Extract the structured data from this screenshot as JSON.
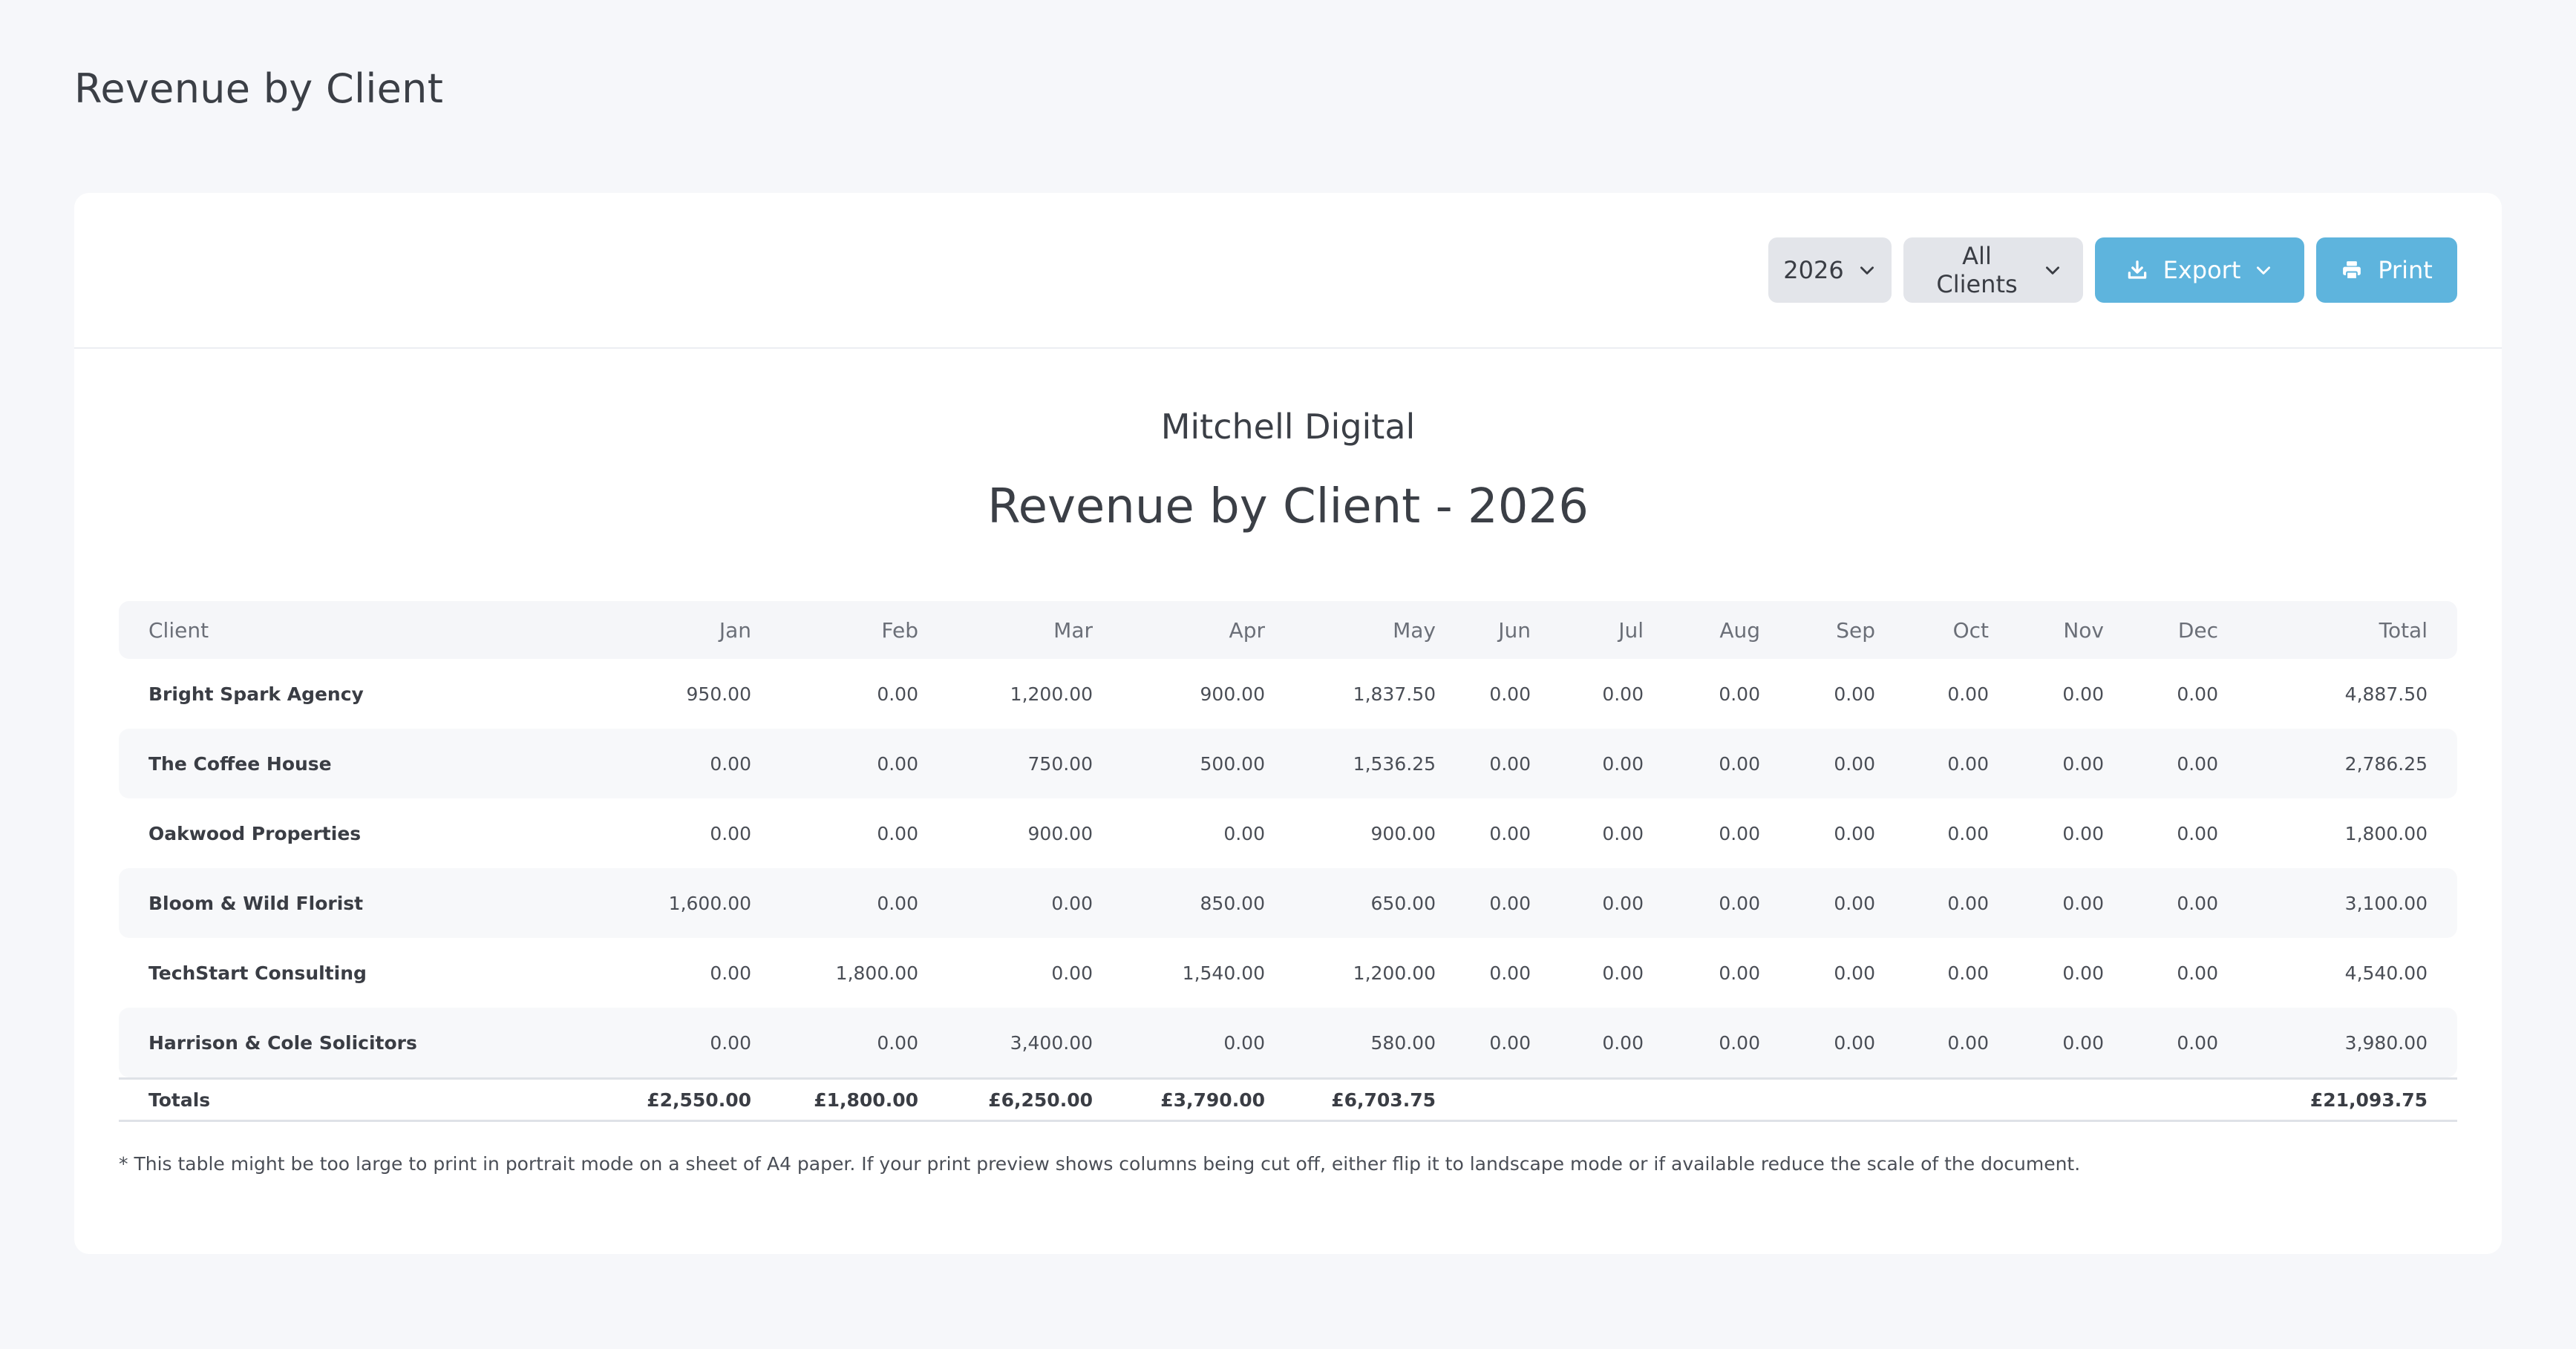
{
  "page": {
    "title": "Revenue by Client"
  },
  "toolbar": {
    "year_label": "2026",
    "client_filter_label": "All Clients",
    "export_label": "Export",
    "print_label": "Print"
  },
  "report": {
    "company": "Mitchell Digital",
    "title": "Revenue by Client - 2026"
  },
  "table": {
    "columns": [
      "Client",
      "Jan",
      "Feb",
      "Mar",
      "Apr",
      "May",
      "Jun",
      "Jul",
      "Aug",
      "Sep",
      "Oct",
      "Nov",
      "Dec",
      "Total"
    ],
    "rows": [
      [
        "Bright Spark Agency",
        "950.00",
        "0.00",
        "1,200.00",
        "900.00",
        "1,837.50",
        "0.00",
        "0.00",
        "0.00",
        "0.00",
        "0.00",
        "0.00",
        "0.00",
        "4,887.50"
      ],
      [
        "The Coffee House",
        "0.00",
        "0.00",
        "750.00",
        "500.00",
        "1,536.25",
        "0.00",
        "0.00",
        "0.00",
        "0.00",
        "0.00",
        "0.00",
        "0.00",
        "2,786.25"
      ],
      [
        "Oakwood Properties",
        "0.00",
        "0.00",
        "900.00",
        "0.00",
        "900.00",
        "0.00",
        "0.00",
        "0.00",
        "0.00",
        "0.00",
        "0.00",
        "0.00",
        "1,800.00"
      ],
      [
        "Bloom & Wild Florist",
        "1,600.00",
        "0.00",
        "0.00",
        "850.00",
        "650.00",
        "0.00",
        "0.00",
        "0.00",
        "0.00",
        "0.00",
        "0.00",
        "0.00",
        "3,100.00"
      ],
      [
        "TechStart Consulting",
        "0.00",
        "1,800.00",
        "0.00",
        "1,540.00",
        "1,200.00",
        "0.00",
        "0.00",
        "0.00",
        "0.00",
        "0.00",
        "0.00",
        "0.00",
        "4,540.00"
      ],
      [
        "Harrison & Cole Solicitors",
        "0.00",
        "0.00",
        "3,400.00",
        "0.00",
        "580.00",
        "0.00",
        "0.00",
        "0.00",
        "0.00",
        "0.00",
        "0.00",
        "0.00",
        "3,980.00"
      ]
    ],
    "totals": [
      "Totals",
      "£2,550.00",
      "£1,800.00",
      "£6,250.00",
      "£3,790.00",
      "£6,703.75",
      "",
      "",
      "",
      "",
      "",
      "",
      "",
      "£21,093.75"
    ]
  },
  "footnote": "* This table might be too large to print in portrait mode on a sheet of A4 paper. If your print preview shows columns being cut off, either flip it to landscape mode or if available reduce the scale of the document.",
  "colors": {
    "accent": "#5eb4dd",
    "background": "#f6f7fa",
    "card": "#ffffff",
    "grey_button": "#e3e5ea"
  },
  "icons": {
    "dropdown": "chevron-down-icon",
    "export": "download-icon",
    "print": "printer-icon"
  }
}
